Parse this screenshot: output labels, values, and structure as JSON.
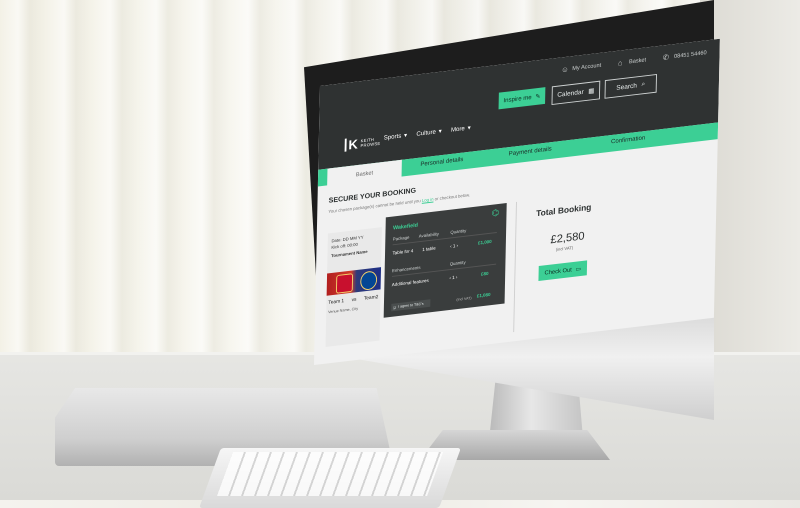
{
  "header": {
    "utility": [
      {
        "icon": "user-icon",
        "label": "My Account"
      },
      {
        "icon": "basket-icon",
        "label": "Basket"
      },
      {
        "icon": "phone-icon",
        "label": "08451 54460"
      }
    ],
    "inspire_label": "Inspire me",
    "calendar_label": "Calendar",
    "search_label": "Search",
    "logo_line1": "KEITH",
    "logo_line2": "PROWSE",
    "logo_letter": "K",
    "nav": [
      {
        "label": "Sports"
      },
      {
        "label": "Culture"
      },
      {
        "label": "More"
      }
    ]
  },
  "steps": {
    "basket": "Basket",
    "personal": "Personal details",
    "payment": "Payment details",
    "confirmation": "Confirmation"
  },
  "booking": {
    "title": "SECURE YOUR BOOKING",
    "subtext_pre": "Your chosen package(s) cannot be held until you",
    "subtext_link": "Log in",
    "subtext_post": "or checkout below."
  },
  "ticket": {
    "date": "Date: DD MM YY",
    "kickoff": "Kick off: 00:00",
    "tournament": "Tournament Name",
    "team1": "Team 1",
    "vs": "vs",
    "team2": "Team2",
    "venue": "Venue Name, City"
  },
  "package_card": {
    "venue": "Wakefield",
    "headers": [
      "Package",
      "Availability",
      "Quantity"
    ],
    "package_name": "Table for 4",
    "availability": "1 table",
    "package_price": "£1,000",
    "enhancements_header": "Enhancements",
    "enhancements_qty": "Quantity",
    "enhancement_name": "Additional features",
    "enhancement_price": "£80",
    "terms": "I agree to T&C's",
    "vat_label": "(Incl VAT)",
    "subtotal": "£1,080"
  },
  "summary": {
    "title": "Total Booking",
    "amount": "£2,580",
    "vat": "(incl VAT)",
    "checkout_label": "Check Out"
  },
  "colors": {
    "accent": "#3ccf95",
    "header": "#2f3232"
  }
}
